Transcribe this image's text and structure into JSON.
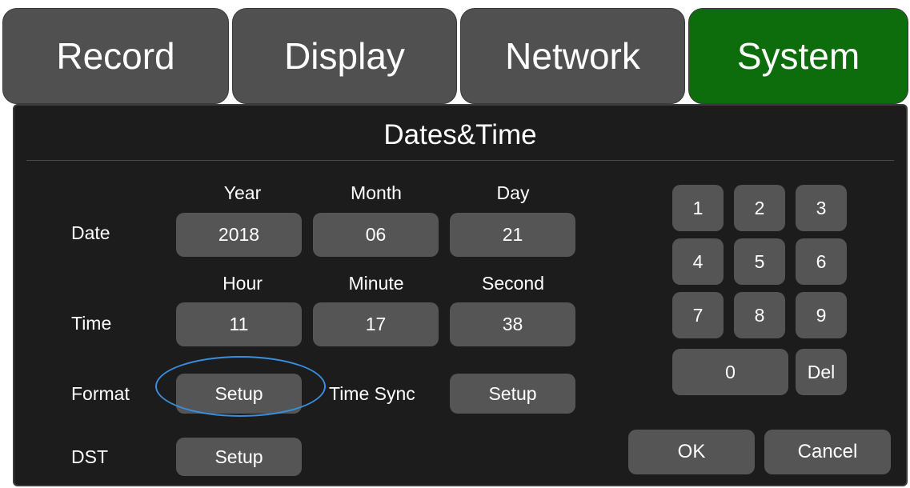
{
  "tabs": {
    "record": "Record",
    "display": "Display",
    "network": "Network",
    "system": "System"
  },
  "panel": {
    "title": "Dates&Time"
  },
  "date": {
    "row_label": "Date",
    "year_header": "Year",
    "month_header": "Month",
    "day_header": "Day",
    "year": "2018",
    "month": "06",
    "day": "21"
  },
  "time": {
    "row_label": "Time",
    "hour_header": "Hour",
    "minute_header": "Minute",
    "second_header": "Second",
    "hour": "11",
    "minute": "17",
    "second": "38"
  },
  "format": {
    "label": "Format",
    "button": "Setup"
  },
  "time_sync": {
    "label": "Time Sync",
    "button": "Setup"
  },
  "dst": {
    "label": "DST",
    "button": "Setup"
  },
  "keypad": {
    "k1": "1",
    "k2": "2",
    "k3": "3",
    "k4": "4",
    "k5": "5",
    "k6": "6",
    "k7": "7",
    "k8": "8",
    "k9": "9",
    "k0": "0",
    "del": "Del"
  },
  "actions": {
    "ok": "OK",
    "cancel": "Cancel"
  },
  "colors": {
    "active_tab": "#0d6d0d",
    "tab": "#505050",
    "button": "#555555",
    "panel": "#1c1c1c",
    "highlight_ring": "#3a8ee0"
  }
}
